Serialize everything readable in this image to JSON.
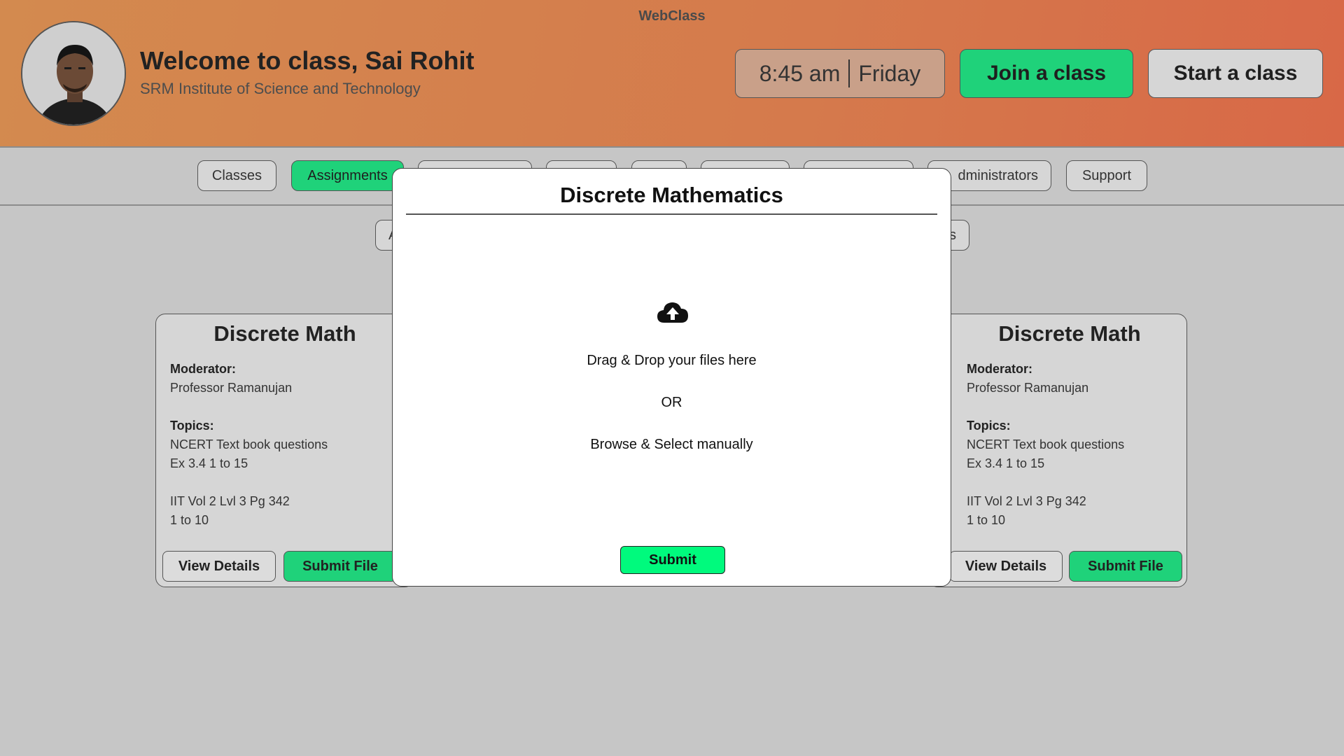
{
  "header": {
    "app_title": "WebClass",
    "welcome": "Welcome to class, Sai Rohit",
    "institute": "SRM Institute of Science and Technology",
    "time": "8:45 am",
    "day": "Friday",
    "join_label": "Join a class",
    "start_label": "Start a class"
  },
  "nav": {
    "classes": "Classes",
    "assignments": "Assignments",
    "administrators_partial": "dministrators",
    "support": "Support"
  },
  "subnav": {
    "left_partial": "A",
    "right_partial": "s"
  },
  "cards": [
    {
      "title": "Discrete Math",
      "moderator_label": "Moderator:",
      "moderator": "Professor Ramanujan",
      "topics_label": "Topics:",
      "topic1_line1": "NCERT Text book questions",
      "topic1_line2": "Ex 3.4 1 to 15",
      "topic2_line1": "IIT Vol 2 Lvl 3 Pg 342",
      "topic2_line2": "1 to 10",
      "view_label": "View Details",
      "submit_label": "Submit File"
    },
    {
      "title": "Discrete Math",
      "moderator_label": "Moderator:",
      "moderator": "Professor Ramanujan",
      "topics_label": "Topics:",
      "topic1_line1": "NCERT Text book questions",
      "topic1_line2": "Ex 3.4 1 to 15",
      "topic2_line1": "IIT Vol 2 Lvl 3 Pg 342",
      "topic2_line2": "1 to 10",
      "view_label": "View Details",
      "submit_label": "Submit File"
    }
  ],
  "modal": {
    "title": "Discrete Mathematics",
    "icon": "cloud-upload-icon",
    "drag_text": "Drag & Drop your files here",
    "or_text": "OR",
    "browse_text": "Browse & Select manually",
    "submit_label": "Submit"
  },
  "colors": {
    "accent_green": "#1fd27a",
    "modal_submit": "#00fa7d",
    "header_start": "#d38a4f",
    "header_end": "#d86847",
    "background": "#c6c6c6"
  }
}
